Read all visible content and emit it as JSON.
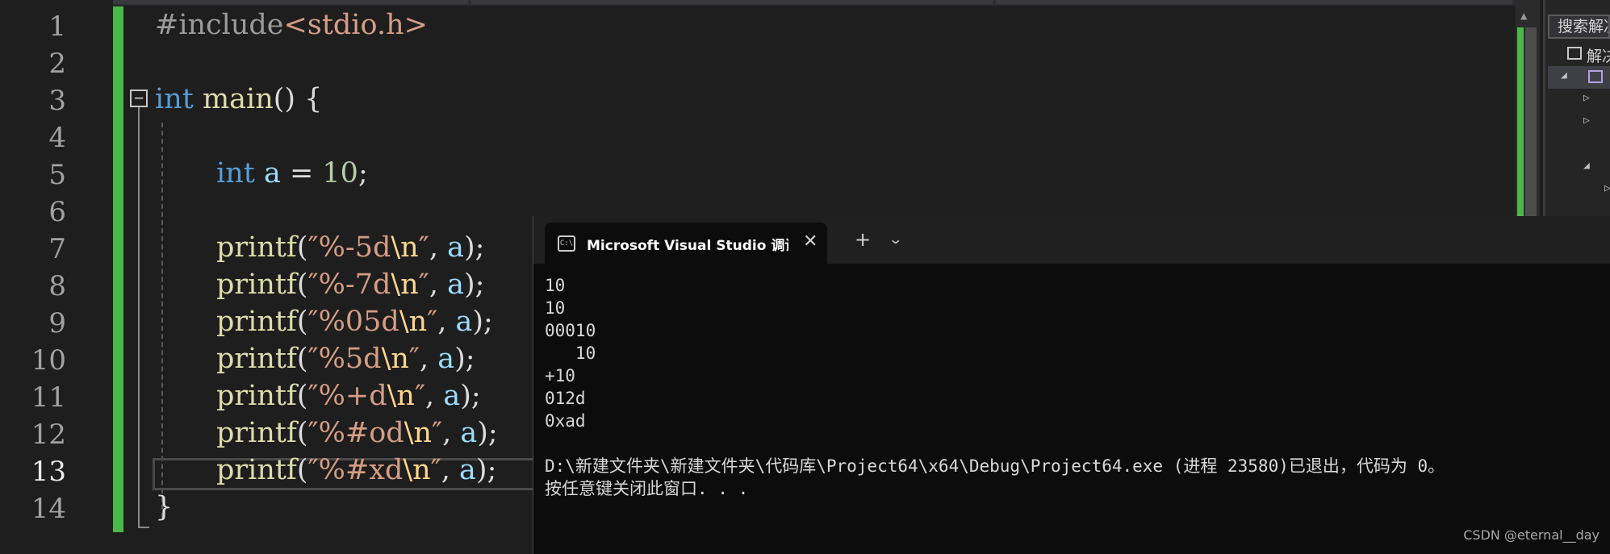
{
  "editor": {
    "line_numbers": [
      "1",
      "2",
      "3",
      "4",
      "5",
      "6",
      "7",
      "8",
      "9",
      "10",
      "11",
      "12",
      "13",
      "14"
    ],
    "current_line": "13",
    "fold_glyph": "−",
    "code": {
      "l1_directive": "#include",
      "l1_header": "<stdio.h>",
      "l3_kw": "int",
      "l3_fn": "main",
      "l3_rest": "() {",
      "l5_kw": "int",
      "l5_var": "a",
      "l5_eq": " = ",
      "l5_num": "10",
      "l5_semi": ";",
      "printf_fn": "printf",
      "open_paren": "(",
      "quote_open": "″",
      "quote_close": "″",
      "newline_esc": "\\n",
      "comma": ", ",
      "var_a": "a",
      "close_stmt": ");",
      "fmt_7": "%-5d",
      "fmt_8": "%-7d",
      "fmt_9": "%05d",
      "fmt_10": "%5d",
      "fmt_11": "%+d",
      "fmt_12": "%#od",
      "fmt_13": "%#xd",
      "l14_brace": "}"
    }
  },
  "solution_explorer": {
    "search_placeholder": "搜索解决方案",
    "root_item": "解决方案"
  },
  "console": {
    "tab_icon": "C:\\",
    "tab_title": "Microsoft Visual Studio 调试控制台",
    "close_glyph": "✕",
    "new_tab_glyph": "+",
    "dropdown_glyph": "⌄",
    "output": "10\n10\n00010\n   10\n+10\n012d\n0xad\n\nD:\\新建文件夹\\新建文件夹\\代码库\\Project64\\x64\\Debug\\Project64.exe (进程 23580)已退出，代码为 0。\n按任意键关闭此窗口. . ."
  },
  "watermark": "CSDN @eternal__day",
  "colors": {
    "editor_bg": "#1e1e1e",
    "change_bar": "#4cb849",
    "keyword": "#569cd6",
    "function": "#dcdcaa",
    "string": "#d69d85",
    "variable": "#9cdcfe",
    "number": "#b5cea8",
    "console_bg": "#0c0c0c"
  }
}
